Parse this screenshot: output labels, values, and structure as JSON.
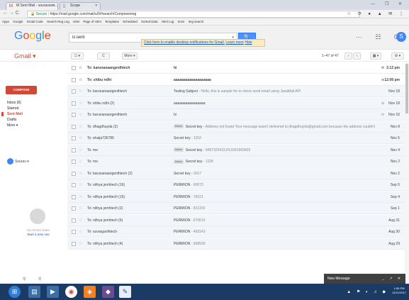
{
  "browser": {
    "tabs": [
      {
        "label": "M  Sent Mail - souravsen..."
      },
      {
        "label": "Scope"
      }
    ],
    "window_controls": "— ❐ ✕",
    "nav_icons": "← → C",
    "url_secure": "Secure",
    "url": "https://mail.google.com/mail/u/0/#search/Composemsg",
    "ext_icons": "☆ ⟳ ● ▲ ✉ ⋮",
    "bookmarks": [
      "Apps",
      "Google",
      "Gmail Code",
      "Search Reg Log",
      "SSN",
      "Page of Html",
      "Templates",
      "Scheduled",
      "Sorted Data",
      "Html Log",
      "Scns",
      "Img search"
    ]
  },
  "header": {
    "logo": "Google",
    "search_value": "is:sent",
    "search_button": "🔍",
    "notification_text": "Click here to enable desktop notifications for Gmail.",
    "notification_learn": "Learn more",
    "notification_hide": "Hide",
    "top_icons": "⋯ ☷ 0",
    "avatar_letter": "S"
  },
  "toolbar": {
    "gmail_label": "Gmail ▾",
    "select_label": "☐ ▾",
    "refresh_label": "C",
    "more_label": "More ▾",
    "pager_text": "1–47 of 47",
    "prev_label": "‹",
    "next_label": "›",
    "settings_label": "⚙ ▾",
    "view_label": "▦ ▾"
  },
  "sidebar": {
    "compose_label": "COMPOSE",
    "items": [
      {
        "label": "Inbox (8)"
      },
      {
        "label": "Starred"
      },
      {
        "label": "Sent Mail"
      },
      {
        "label": "Drafts"
      },
      {
        "label": "More ▾"
      }
    ],
    "user": "Sourav ▾",
    "no_chats": "No recent chats",
    "start_new": "Start a new one",
    "bottom_icons": "⚲ ⚲"
  },
  "emails": [
    {
      "to": "To: karunanaangenlhtech",
      "label": "",
      "subject": "hi",
      "snippet": "",
      "icon": "✉",
      "date": "2:12 pm"
    },
    {
      "to": "To: shibu ndhi",
      "label": "",
      "subject": "aaaaaaaaaaaaaaaaaaa",
      "snippet": "",
      "icon": "⊕",
      "date": "12:06 pm"
    },
    {
      "to": "To: karunanaangenlhtech",
      "label": "",
      "subject": "Testing Subject",
      "snippet": " - Hello, this is sample for to check send email using JavaMail API",
      "icon": "",
      "date": "Nov 18"
    },
    {
      "to": "To: shibu ndhi (2)",
      "label": "",
      "subject": "aaaaaaaaaaaaaaaa",
      "snippet": "",
      "icon": "⊕",
      "date": "Nov 18"
    },
    {
      "to": "To: karunanaangenlhtech",
      "label": "",
      "subject": "hi",
      "snippet": "",
      "icon": "✉",
      "date": "Nov 16"
    },
    {
      "to": "To: dhagdhuyda (2)",
      "label": "Inbox",
      "subject": "Secret key",
      "snippet": " - Address not found Your message wasn't delivered to dhagdhuyda@gmail.com because the address couldn't be f",
      "icon": "",
      "date": "Nov 8"
    },
    {
      "to": "To: shaija736780",
      "label": "",
      "subject": "Secret key",
      "snippet": " - 1153",
      "icon": "",
      "date": "Nov 5"
    },
    {
      "to": "To: me",
      "label": "Inbox",
      "subject": "Secret key",
      "snippet": " - 0497323419,HL0341563402",
      "icon": "",
      "date": "Nov 4"
    },
    {
      "to": "To: me",
      "label": "Inbox",
      "subject": "Secret key",
      "snippet": " - 1236",
      "icon": "",
      "date": "Nov 2"
    },
    {
      "to": "To: karunanaangenlhtech (2)",
      "label": "",
      "subject": "Secret key",
      "snippet": " - 0017",
      "icon": "",
      "date": "Nov 2"
    },
    {
      "to": "To: nithya jsmhtech (16)",
      "label": "",
      "subject": "PERMION",
      "snippet": " - 60073",
      "icon": "",
      "date": "Sep 5"
    },
    {
      "to": "To: nithya jsmhtech (15)",
      "label": "",
      "subject": "PERMION",
      "snippet": " - 76021",
      "icon": "",
      "date": "Sep 4"
    },
    {
      "to": "To: nithya jsmhtech (2)",
      "label": "",
      "subject": "PERMION",
      "snippet": " - 821159",
      "icon": "",
      "date": "Sep 1"
    },
    {
      "to": "To: nithya jsmhtech (6)",
      "label": "",
      "subject": "PERMION",
      "snippet": " - 670610",
      "icon": "",
      "date": "Aug 31"
    },
    {
      "to": "To: suvarganlhtech",
      "label": "",
      "subject": "PERMION",
      "snippet": " - 493143",
      "icon": "",
      "date": "Aug 30"
    },
    {
      "to": "To: nithya jsmhtech (4)",
      "label": "",
      "subject": "PERMION",
      "snippet": " - 669539",
      "icon": "",
      "date": "Aug 29"
    }
  ],
  "new_message": {
    "label": "New Message",
    "controls": "_ ↗ ✕"
  },
  "taskbar": {
    "tray": "▲ ⚑ ◐ ♫ ◆",
    "time": "1:55 PM",
    "date": "11/21/2017"
  }
}
